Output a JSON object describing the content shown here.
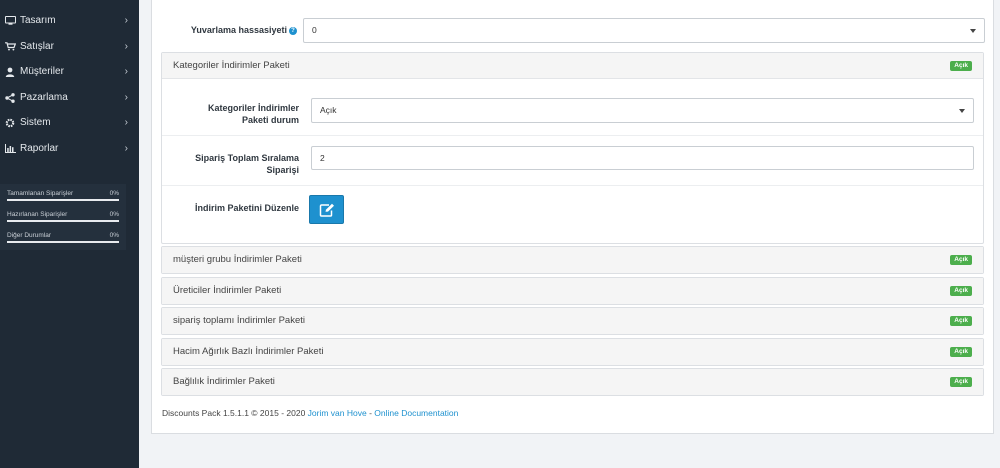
{
  "sidebar": {
    "menu": [
      {
        "label": "Tasarım",
        "icon": "monitor-icon"
      },
      {
        "label": "Satışlar",
        "icon": "cart-icon"
      },
      {
        "label": "Müşteriler",
        "icon": "user-icon"
      },
      {
        "label": "Pazarlama",
        "icon": "share-icon"
      },
      {
        "label": "Sistem",
        "icon": "gear-icon"
      },
      {
        "label": "Raporlar",
        "icon": "bar-chart-icon"
      }
    ],
    "progress": [
      {
        "label": "Tamamlanan Siparişler",
        "value": "0%"
      },
      {
        "label": "Hazırlanan Siparişler",
        "value": "0%"
      },
      {
        "label": "Diğer Durumlar",
        "value": "0%"
      }
    ]
  },
  "main": {
    "rounding": {
      "label": "Yuvarlama hassasiyeti",
      "value": "0"
    },
    "category_package": {
      "title": "Kategoriler İndirimler Paketi",
      "status": "Açık",
      "status_field": {
        "label_line1": "Kategoriler İndirimler",
        "label_line2": "Paketi durum",
        "value": "Açık"
      },
      "sort_field": {
        "label_line1": "Sipariş Toplam Sıralama",
        "label_line2": "Siparişi",
        "value": "2"
      },
      "edit_field": {
        "label": "İndirim Paketini Düzenle"
      }
    },
    "packages": [
      {
        "title": "müşteri grubu İndirimler Paketi",
        "status": "Açık"
      },
      {
        "title": "Üreticiler İndirimler Paketi",
        "status": "Açık"
      },
      {
        "title": "sipariş toplamı İndirimler Paketi",
        "status": "Açık"
      },
      {
        "title": "Hacim Ağırlık Bazlı İndirimler Paketi",
        "status": "Açık"
      },
      {
        "title": "Bağlılık İndirimler Paketi",
        "status": "Açık"
      }
    ],
    "footer": {
      "text": "Discounts Pack 1.5.1.1 © 2015 - 2020 ",
      "author": "Jorim van Hove",
      "sep": " - ",
      "doc": "Online Documentation"
    }
  },
  "colors": {
    "sidebar_bg": "#1f2a36",
    "accent": "#1e91cf",
    "badge": "#4cae4c"
  }
}
